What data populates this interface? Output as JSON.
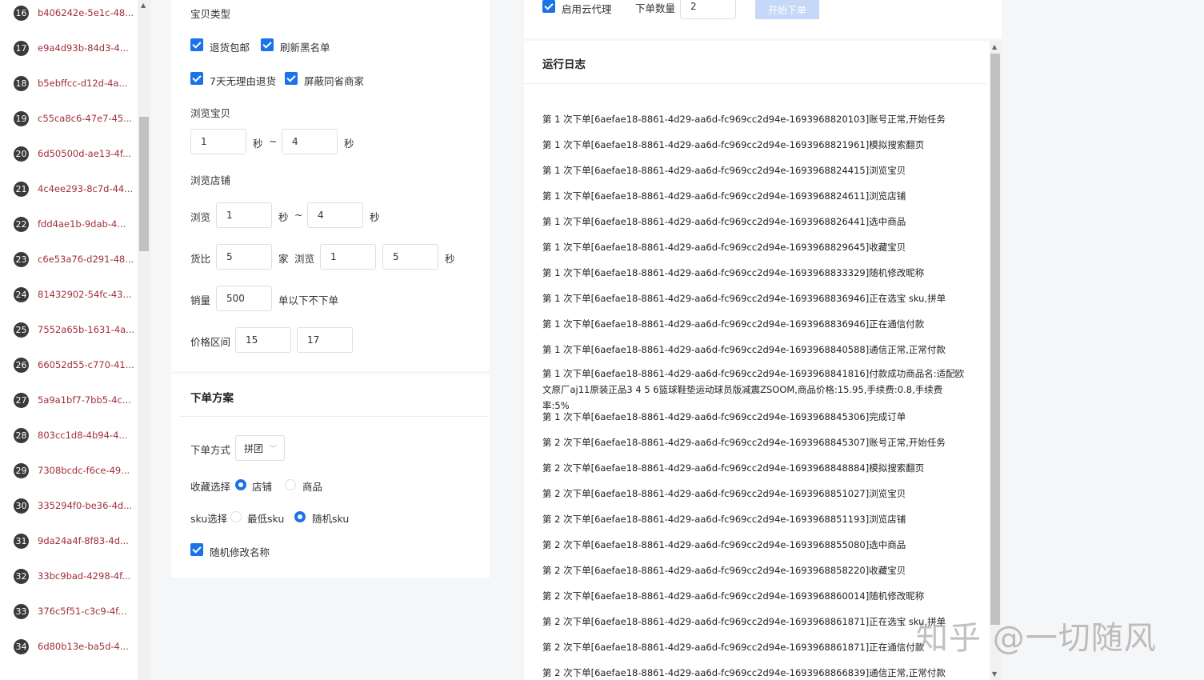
{
  "accounts": [
    {
      "num": "16",
      "id": "b406242e-5e1c-48..."
    },
    {
      "num": "17",
      "id": "e9a4d93b-84d3-4..."
    },
    {
      "num": "18",
      "id": "b5ebffcc-d12d-4a..."
    },
    {
      "num": "19",
      "id": "c55ca8c6-47e7-45..."
    },
    {
      "num": "20",
      "id": "6d50500d-ae13-4f..."
    },
    {
      "num": "21",
      "id": "4c4ee293-8c7d-44..."
    },
    {
      "num": "22",
      "id": "fdd4ae1b-9dab-4..."
    },
    {
      "num": "23",
      "id": "c6e53a76-d291-48..."
    },
    {
      "num": "24",
      "id": "81432902-54fc-43..."
    },
    {
      "num": "25",
      "id": "7552a65b-1631-4a..."
    },
    {
      "num": "26",
      "id": "66052d55-c770-41..."
    },
    {
      "num": "27",
      "id": "5a9a1bf7-7bb5-4c..."
    },
    {
      "num": "28",
      "id": "803cc1d8-4b94-4..."
    },
    {
      "num": "29",
      "id": "7308bcdc-f6ce-49..."
    },
    {
      "num": "30",
      "id": "335294f0-be36-4d..."
    },
    {
      "num": "31",
      "id": "9da24a4f-8f83-4d..."
    },
    {
      "num": "32",
      "id": "33bc9bad-4298-4f..."
    },
    {
      "num": "33",
      "id": "376c5f51-c3c9-4f..."
    },
    {
      "num": "34",
      "id": "6d80b13e-ba5d-4..."
    }
  ],
  "config": {
    "item_type_label": "宝贝类型",
    "cb_return_shipping": "退货包邮",
    "cb_refresh_blacklist": "刷新黑名单",
    "cb_7day_return": "7天无理由退货",
    "cb_block_same_province": "屏蔽同省商家",
    "browse_item_label": "浏览宝贝",
    "browse_item_min": "1",
    "browse_item_max": "4",
    "sec_unit": "秒",
    "tilde": "~",
    "browse_shop_label": "浏览店铺",
    "browse_label": "浏览",
    "browse_shop_min": "1",
    "browse_shop_max": "4",
    "compare_label": "货比",
    "compare_count": "5",
    "shop_unit": "家",
    "compare_browse_min": "1",
    "compare_browse_max": "5",
    "sales_label": "销量",
    "sales_value": "500",
    "sales_suffix": "单以下不下单",
    "price_range_label": "价格区间",
    "price_min": "15",
    "price_max": "17"
  },
  "order_plan": {
    "title": "下单方案",
    "method_label": "下单方式",
    "method_value": "拼团",
    "fav_label": "收藏选择",
    "fav_shop": "店铺",
    "fav_item": "商品",
    "sku_label": "sku选择",
    "sku_lowest": "最低sku",
    "sku_random": "随机sku",
    "cb_random_rename": "随机修改名称"
  },
  "topbar": {
    "cloud_proxy_label": "启用云代理",
    "order_count_label": "下单数量",
    "order_count_value": "2",
    "start_button": "开始下单"
  },
  "log": {
    "title": "运行日志",
    "lines": [
      "第 1 次下单[6aefae18-8861-4d29-aa6d-fc969cc2d94e-1693968820103]账号正常,开始任务",
      "第 1 次下单[6aefae18-8861-4d29-aa6d-fc969cc2d94e-1693968821961]模拟搜索翻页",
      "第 1 次下单[6aefae18-8861-4d29-aa6d-fc969cc2d94e-1693968824415]浏览宝贝",
      "第 1 次下单[6aefae18-8861-4d29-aa6d-fc969cc2d94e-1693968824611]浏览店铺",
      "第 1 次下单[6aefae18-8861-4d29-aa6d-fc969cc2d94e-1693968826441]选中商品",
      "第 1 次下单[6aefae18-8861-4d29-aa6d-fc969cc2d94e-1693968829645]收藏宝贝",
      "第 1 次下单[6aefae18-8861-4d29-aa6d-fc969cc2d94e-1693968833329]随机修改昵称",
      "第 1 次下单[6aefae18-8861-4d29-aa6d-fc969cc2d94e-1693968836946]正在选宝 sku,拼单",
      "第 1 次下单[6aefae18-8861-4d29-aa6d-fc969cc2d94e-1693968836946]正在通信付款",
      "第 1 次下单[6aefae18-8861-4d29-aa6d-fc969cc2d94e-1693968840588]通信正常,正常付款",
      "第 1 次下单[6aefae18-8861-4d29-aa6d-fc969cc2d94e-1693968841816]付款成功商品名:适配欧文原厂aj11原装正品3 4 5 6篮球鞋垫运动球员版减震ZSOOM,商品价格:15.95,手续费:0.8,手续费率:5%",
      "第 1 次下单[6aefae18-8861-4d29-aa6d-fc969cc2d94e-1693968845306]完成订单",
      "第 2 次下单[6aefae18-8861-4d29-aa6d-fc969cc2d94e-1693968845307]账号正常,开始任务",
      "第 2 次下单[6aefae18-8861-4d29-aa6d-fc969cc2d94e-1693968848884]模拟搜索翻页",
      "第 2 次下单[6aefae18-8861-4d29-aa6d-fc969cc2d94e-1693968851027]浏览宝贝",
      "第 2 次下单[6aefae18-8861-4d29-aa6d-fc969cc2d94e-1693968851193]浏览店铺",
      "第 2 次下单[6aefae18-8861-4d29-aa6d-fc969cc2d94e-1693968855080]选中商品",
      "第 2 次下单[6aefae18-8861-4d29-aa6d-fc969cc2d94e-1693968858220]收藏宝贝",
      "第 2 次下单[6aefae18-8861-4d29-aa6d-fc969cc2d94e-1693968860014]随机修改昵称",
      "第 2 次下单[6aefae18-8861-4d29-aa6d-fc969cc2d94e-1693968861871]正在选宝 sku,拼单",
      "第 2 次下单[6aefae18-8861-4d29-aa6d-fc969cc2d94e-1693968861871]正在通信付款",
      "第 2 次下单[6aefae18-8861-4d29-aa6d-fc969cc2d94e-1693968866839]通信正常,正常付款"
    ]
  },
  "watermark": "知乎 @一切随风"
}
